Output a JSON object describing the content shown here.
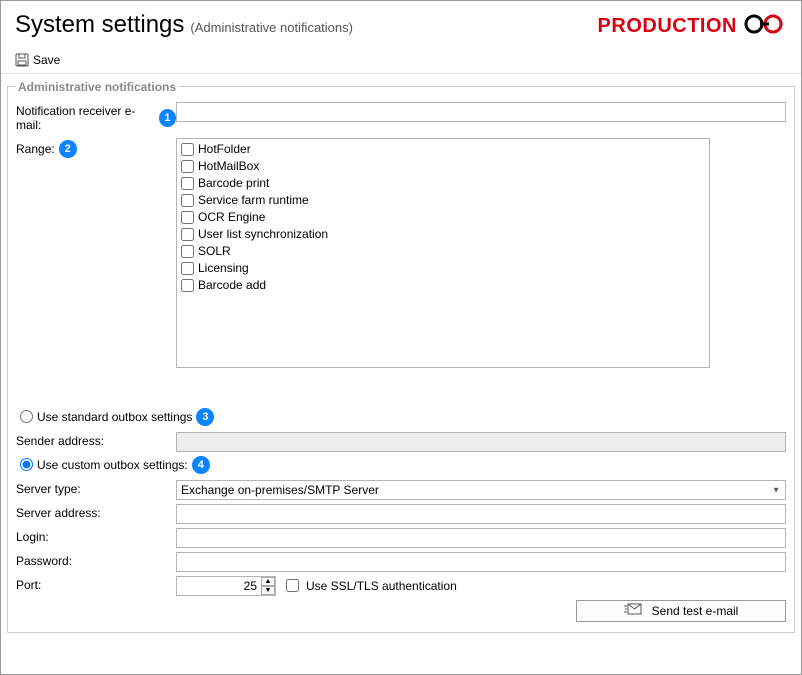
{
  "header": {
    "title": "System settings",
    "subtitle": "(Administrative notifications)",
    "brand": "PRODUCTION"
  },
  "toolbar": {
    "save_label": "Save"
  },
  "group": {
    "legend": "Administrative notifications"
  },
  "labels": {
    "receiver": "Notification receiver e-mail:",
    "range": "Range:",
    "use_standard": "Use standard outbox settings",
    "sender_address": "Sender address:",
    "use_custom": "Use custom outbox settings:",
    "server_type": "Server type:",
    "server_address": "Server address:",
    "login": "Login:",
    "password": "Password:",
    "port": "Port:",
    "use_ssl": "Use SSL/TLS authentication",
    "send_test": "Send test e-mail"
  },
  "range_items": [
    "HotFolder",
    "HotMailBox",
    "Barcode print",
    "Service farm runtime",
    "OCR Engine",
    "User list synchronization",
    "SOLR",
    "Licensing",
    "Barcode add"
  ],
  "fields": {
    "receiver": "",
    "sender_address": "",
    "server_type_selected": "Exchange on-premises/SMTP Server",
    "server_address": "",
    "login": "",
    "password": "",
    "port": "25"
  },
  "callouts": {
    "c1": "1",
    "c2": "2",
    "c3": "3",
    "c4": "4"
  }
}
